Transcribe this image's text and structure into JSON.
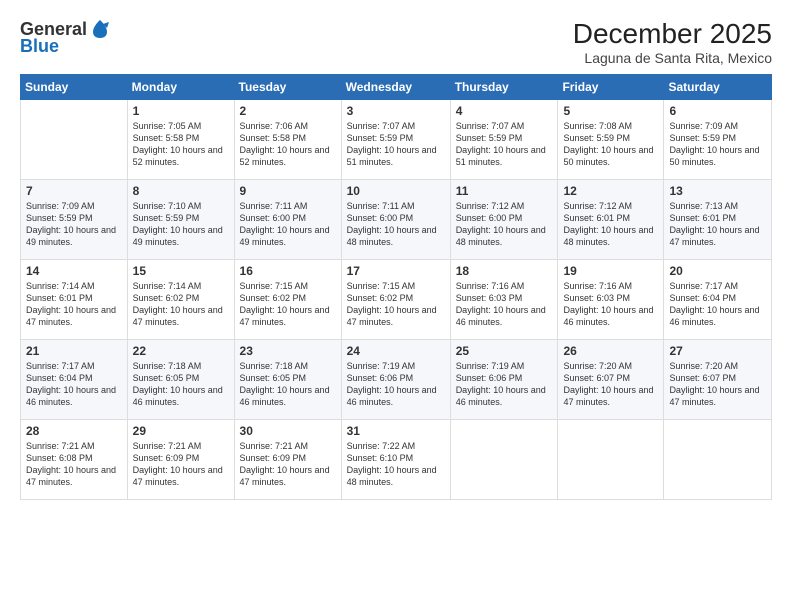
{
  "header": {
    "logo_line1": "General",
    "logo_line2": "Blue",
    "month": "December 2025",
    "location": "Laguna de Santa Rita, Mexico"
  },
  "days_of_week": [
    "Sunday",
    "Monday",
    "Tuesday",
    "Wednesday",
    "Thursday",
    "Friday",
    "Saturday"
  ],
  "weeks": [
    [
      {
        "day": "",
        "sunrise": "",
        "sunset": "",
        "daylight": ""
      },
      {
        "day": "1",
        "sunrise": "Sunrise: 7:05 AM",
        "sunset": "Sunset: 5:58 PM",
        "daylight": "Daylight: 10 hours and 52 minutes."
      },
      {
        "day": "2",
        "sunrise": "Sunrise: 7:06 AM",
        "sunset": "Sunset: 5:58 PM",
        "daylight": "Daylight: 10 hours and 52 minutes."
      },
      {
        "day": "3",
        "sunrise": "Sunrise: 7:07 AM",
        "sunset": "Sunset: 5:59 PM",
        "daylight": "Daylight: 10 hours and 51 minutes."
      },
      {
        "day": "4",
        "sunrise": "Sunrise: 7:07 AM",
        "sunset": "Sunset: 5:59 PM",
        "daylight": "Daylight: 10 hours and 51 minutes."
      },
      {
        "day": "5",
        "sunrise": "Sunrise: 7:08 AM",
        "sunset": "Sunset: 5:59 PM",
        "daylight": "Daylight: 10 hours and 50 minutes."
      },
      {
        "day": "6",
        "sunrise": "Sunrise: 7:09 AM",
        "sunset": "Sunset: 5:59 PM",
        "daylight": "Daylight: 10 hours and 50 minutes."
      }
    ],
    [
      {
        "day": "7",
        "sunrise": "Sunrise: 7:09 AM",
        "sunset": "Sunset: 5:59 PM",
        "daylight": "Daylight: 10 hours and 49 minutes."
      },
      {
        "day": "8",
        "sunrise": "Sunrise: 7:10 AM",
        "sunset": "Sunset: 5:59 PM",
        "daylight": "Daylight: 10 hours and 49 minutes."
      },
      {
        "day": "9",
        "sunrise": "Sunrise: 7:11 AM",
        "sunset": "Sunset: 6:00 PM",
        "daylight": "Daylight: 10 hours and 49 minutes."
      },
      {
        "day": "10",
        "sunrise": "Sunrise: 7:11 AM",
        "sunset": "Sunset: 6:00 PM",
        "daylight": "Daylight: 10 hours and 48 minutes."
      },
      {
        "day": "11",
        "sunrise": "Sunrise: 7:12 AM",
        "sunset": "Sunset: 6:00 PM",
        "daylight": "Daylight: 10 hours and 48 minutes."
      },
      {
        "day": "12",
        "sunrise": "Sunrise: 7:12 AM",
        "sunset": "Sunset: 6:01 PM",
        "daylight": "Daylight: 10 hours and 48 minutes."
      },
      {
        "day": "13",
        "sunrise": "Sunrise: 7:13 AM",
        "sunset": "Sunset: 6:01 PM",
        "daylight": "Daylight: 10 hours and 47 minutes."
      }
    ],
    [
      {
        "day": "14",
        "sunrise": "Sunrise: 7:14 AM",
        "sunset": "Sunset: 6:01 PM",
        "daylight": "Daylight: 10 hours and 47 minutes."
      },
      {
        "day": "15",
        "sunrise": "Sunrise: 7:14 AM",
        "sunset": "Sunset: 6:02 PM",
        "daylight": "Daylight: 10 hours and 47 minutes."
      },
      {
        "day": "16",
        "sunrise": "Sunrise: 7:15 AM",
        "sunset": "Sunset: 6:02 PM",
        "daylight": "Daylight: 10 hours and 47 minutes."
      },
      {
        "day": "17",
        "sunrise": "Sunrise: 7:15 AM",
        "sunset": "Sunset: 6:02 PM",
        "daylight": "Daylight: 10 hours and 47 minutes."
      },
      {
        "day": "18",
        "sunrise": "Sunrise: 7:16 AM",
        "sunset": "Sunset: 6:03 PM",
        "daylight": "Daylight: 10 hours and 46 minutes."
      },
      {
        "day": "19",
        "sunrise": "Sunrise: 7:16 AM",
        "sunset": "Sunset: 6:03 PM",
        "daylight": "Daylight: 10 hours and 46 minutes."
      },
      {
        "day": "20",
        "sunrise": "Sunrise: 7:17 AM",
        "sunset": "Sunset: 6:04 PM",
        "daylight": "Daylight: 10 hours and 46 minutes."
      }
    ],
    [
      {
        "day": "21",
        "sunrise": "Sunrise: 7:17 AM",
        "sunset": "Sunset: 6:04 PM",
        "daylight": "Daylight: 10 hours and 46 minutes."
      },
      {
        "day": "22",
        "sunrise": "Sunrise: 7:18 AM",
        "sunset": "Sunset: 6:05 PM",
        "daylight": "Daylight: 10 hours and 46 minutes."
      },
      {
        "day": "23",
        "sunrise": "Sunrise: 7:18 AM",
        "sunset": "Sunset: 6:05 PM",
        "daylight": "Daylight: 10 hours and 46 minutes."
      },
      {
        "day": "24",
        "sunrise": "Sunrise: 7:19 AM",
        "sunset": "Sunset: 6:06 PM",
        "daylight": "Daylight: 10 hours and 46 minutes."
      },
      {
        "day": "25",
        "sunrise": "Sunrise: 7:19 AM",
        "sunset": "Sunset: 6:06 PM",
        "daylight": "Daylight: 10 hours and 46 minutes."
      },
      {
        "day": "26",
        "sunrise": "Sunrise: 7:20 AM",
        "sunset": "Sunset: 6:07 PM",
        "daylight": "Daylight: 10 hours and 47 minutes."
      },
      {
        "day": "27",
        "sunrise": "Sunrise: 7:20 AM",
        "sunset": "Sunset: 6:07 PM",
        "daylight": "Daylight: 10 hours and 47 minutes."
      }
    ],
    [
      {
        "day": "28",
        "sunrise": "Sunrise: 7:21 AM",
        "sunset": "Sunset: 6:08 PM",
        "daylight": "Daylight: 10 hours and 47 minutes."
      },
      {
        "day": "29",
        "sunrise": "Sunrise: 7:21 AM",
        "sunset": "Sunset: 6:09 PM",
        "daylight": "Daylight: 10 hours and 47 minutes."
      },
      {
        "day": "30",
        "sunrise": "Sunrise: 7:21 AM",
        "sunset": "Sunset: 6:09 PM",
        "daylight": "Daylight: 10 hours and 47 minutes."
      },
      {
        "day": "31",
        "sunrise": "Sunrise: 7:22 AM",
        "sunset": "Sunset: 6:10 PM",
        "daylight": "Daylight: 10 hours and 48 minutes."
      },
      {
        "day": "",
        "sunrise": "",
        "sunset": "",
        "daylight": ""
      },
      {
        "day": "",
        "sunrise": "",
        "sunset": "",
        "daylight": ""
      },
      {
        "day": "",
        "sunrise": "",
        "sunset": "",
        "daylight": ""
      }
    ]
  ]
}
